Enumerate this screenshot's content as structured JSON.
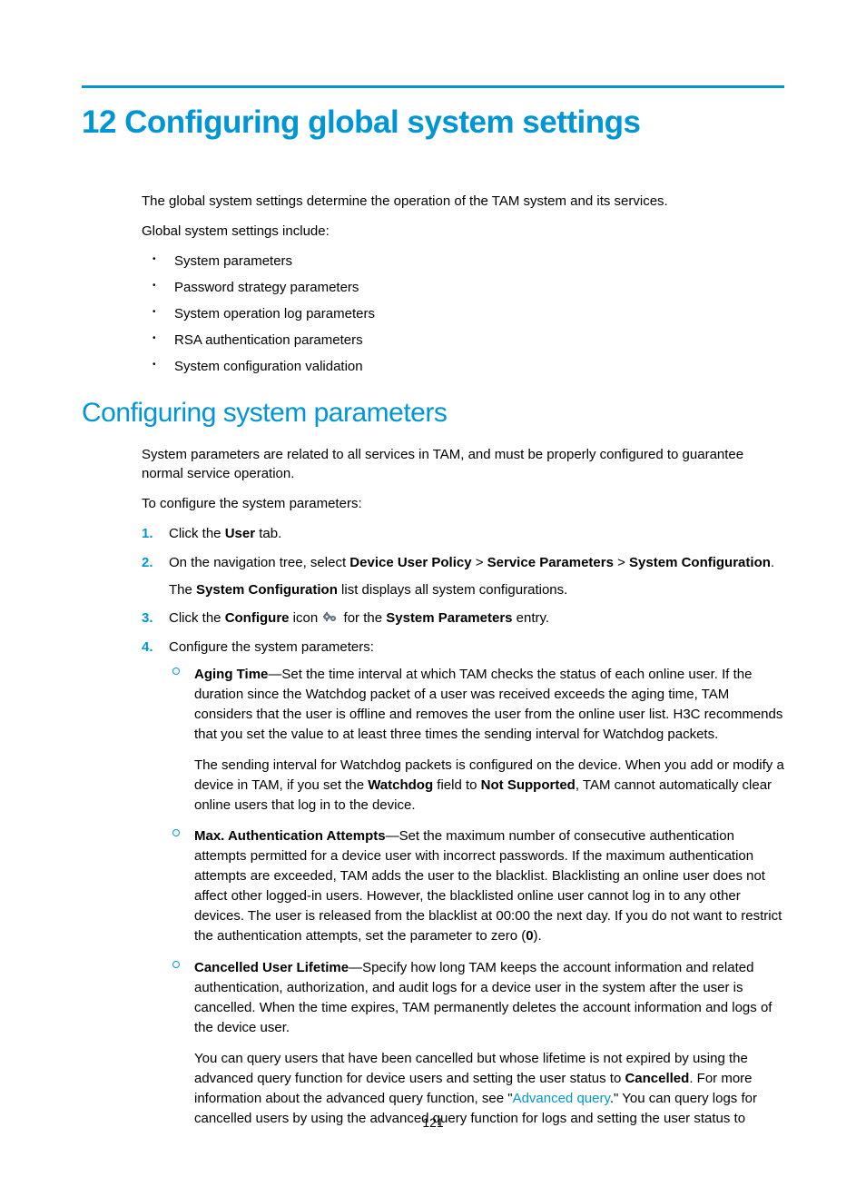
{
  "chapter": {
    "title": "12 Configuring global system settings"
  },
  "intro": {
    "p1": "The global system settings determine the operation of the TAM system and its services.",
    "p2": "Global system settings include:",
    "bullets": [
      "System parameters",
      "Password strategy parameters",
      "System operation log parameters",
      "RSA authentication parameters",
      "System configuration validation"
    ]
  },
  "section": {
    "title": "Configuring system parameters",
    "p1": "System parameters are related to all services in TAM, and must be properly configured to guarantee normal service operation.",
    "p2": "To configure the system parameters:"
  },
  "steps": {
    "s1": {
      "num": "1.",
      "a": "Click the ",
      "b": "User",
      "c": " tab."
    },
    "s2": {
      "num": "2.",
      "a": "On the navigation tree, select ",
      "b": "Device User Policy",
      "c": " > ",
      "d": "Service Parameters",
      "e": " > ",
      "f": "System Configuration",
      "g": ".",
      "sub_a": "The ",
      "sub_b": "System Configuration",
      "sub_c": " list displays all system configurations."
    },
    "s3": {
      "num": "3.",
      "a": "Click the ",
      "b": "Configure",
      "c": " icon ",
      "d": " for the ",
      "e": "System Parameters",
      "f": " entry."
    },
    "s4": {
      "num": "4.",
      "a": "Configure the system parameters:"
    }
  },
  "params": {
    "aging": {
      "label": "Aging Time",
      "text": "—Set the time interval at which TAM checks the status of each online user. If the duration since the Watchdog packet of a user was received exceeds the aging time, TAM considers that the user is offline and removes the user from the online user list. H3C recommends that you set the value to at least three times the sending interval for Watchdog packets.",
      "follow_a": "The sending interval for Watchdog packets is configured on the device. When you add or modify a device in TAM, if you set the ",
      "follow_b": "Watchdog",
      "follow_c": " field to ",
      "follow_d": "Not Supported",
      "follow_e": ", TAM cannot automatically clear online users that log in to the device."
    },
    "max": {
      "label": "Max. Authentication Attempts",
      "text_a": "—Set the maximum number of consecutive authentication attempts permitted for a device user with incorrect passwords. If the maximum authentication attempts are exceeded, TAM adds the user to the blacklist. Blacklisting an online user does not affect other logged-in users. However, the blacklisted online user cannot log in to any other devices. The user is released from the blacklist at 00:00 the next day. If you do not want to restrict the authentication attempts, set the parameter to zero (",
      "text_b": "0",
      "text_c": ")."
    },
    "cancelled": {
      "label": "Cancelled User Lifetime",
      "text": "—Specify how long TAM keeps the account information and related authentication, authorization, and audit logs for a device user in the system after the user is cancelled. When the time expires, TAM permanently deletes the account information and logs of the device user.",
      "follow_a": "You can query users that have been cancelled but whose lifetime is not expired by using the advanced query function for device users and setting the user status to ",
      "follow_b": "Cancelled",
      "follow_c": ". For more information about the advanced query function, see \"",
      "follow_link": "Advanced query",
      "follow_d": ".\" You can query logs for cancelled users by using the advanced query function for logs and setting the user status to"
    }
  },
  "page_number": "121"
}
